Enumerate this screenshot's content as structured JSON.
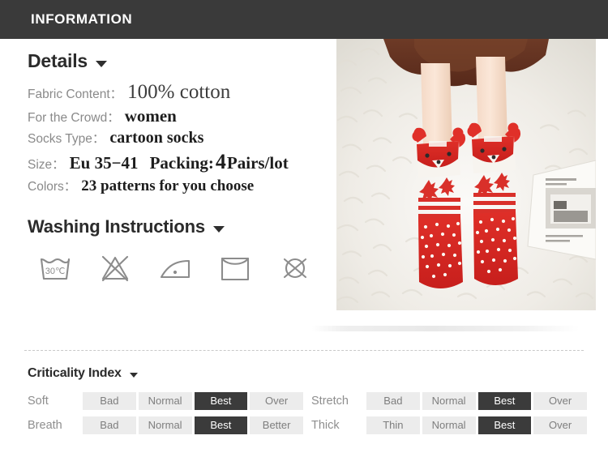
{
  "header": {
    "title": "INFORMATION"
  },
  "details": {
    "heading": "Details",
    "caret_icon": "chevron-down-icon",
    "rows": [
      {
        "label": "Fabric Content：",
        "value": "100% cotton"
      },
      {
        "label": "For the Crowd：",
        "value": "women"
      },
      {
        "label": "Socks Type：",
        "value": "cartoon socks"
      }
    ],
    "size_row": {
      "label": "Size：",
      "value": "Eu 35−41",
      "packing_label": "Packing:",
      "packing_number": "4",
      "packing_unit": "Pairs/lot"
    },
    "colors_row": {
      "label": "Colors：",
      "value": "23 patterns for you choose"
    }
  },
  "washing": {
    "heading": "Washing Instructions",
    "caret_icon": "chevron-down-icon",
    "icons": [
      {
        "name": "wash-30c-icon",
        "label": "30℃"
      },
      {
        "name": "do-not-bleach-icon",
        "label": ""
      },
      {
        "name": "iron-low-icon",
        "label": ""
      },
      {
        "name": "drip-dry-icon",
        "label": ""
      },
      {
        "name": "do-not-dry-clean-icon",
        "label": ""
      }
    ]
  },
  "product_image": {
    "name": "product-photo",
    "alt": "Legs wearing red cartoon fox socks on a white fluffy rug"
  },
  "criticality": {
    "heading": "Criticality Index",
    "caret_icon": "chevron-down-icon",
    "rows": [
      {
        "label": "Soft",
        "cells": [
          {
            "text": "Bad",
            "active": false
          },
          {
            "text": "Normal",
            "active": false
          },
          {
            "text": "Best",
            "active": true
          },
          {
            "text": "Over",
            "active": false
          }
        ]
      },
      {
        "label": "Stretch",
        "cells": [
          {
            "text": "Bad",
            "active": false
          },
          {
            "text": "Normal",
            "active": false
          },
          {
            "text": "Best",
            "active": true
          },
          {
            "text": "Over",
            "active": false
          }
        ]
      },
      {
        "label": "Breath",
        "cells": [
          {
            "text": "Bad",
            "active": false
          },
          {
            "text": "Normal",
            "active": false
          },
          {
            "text": "Best",
            "active": true
          },
          {
            "text": "Better",
            "active": false
          }
        ]
      },
      {
        "label": "Thick",
        "cells": [
          {
            "text": "Thin",
            "active": false
          },
          {
            "text": "Normal",
            "active": false
          },
          {
            "text": "Best",
            "active": true
          },
          {
            "text": "Over",
            "active": false
          }
        ]
      }
    ]
  },
  "colors": {
    "header_bg": "#3a3a3a",
    "cell_bg": "#ececec",
    "cell_active_bg": "#3b3b3b",
    "label_gray": "#8a8a8a",
    "text_dark": "#1d1d1d"
  }
}
